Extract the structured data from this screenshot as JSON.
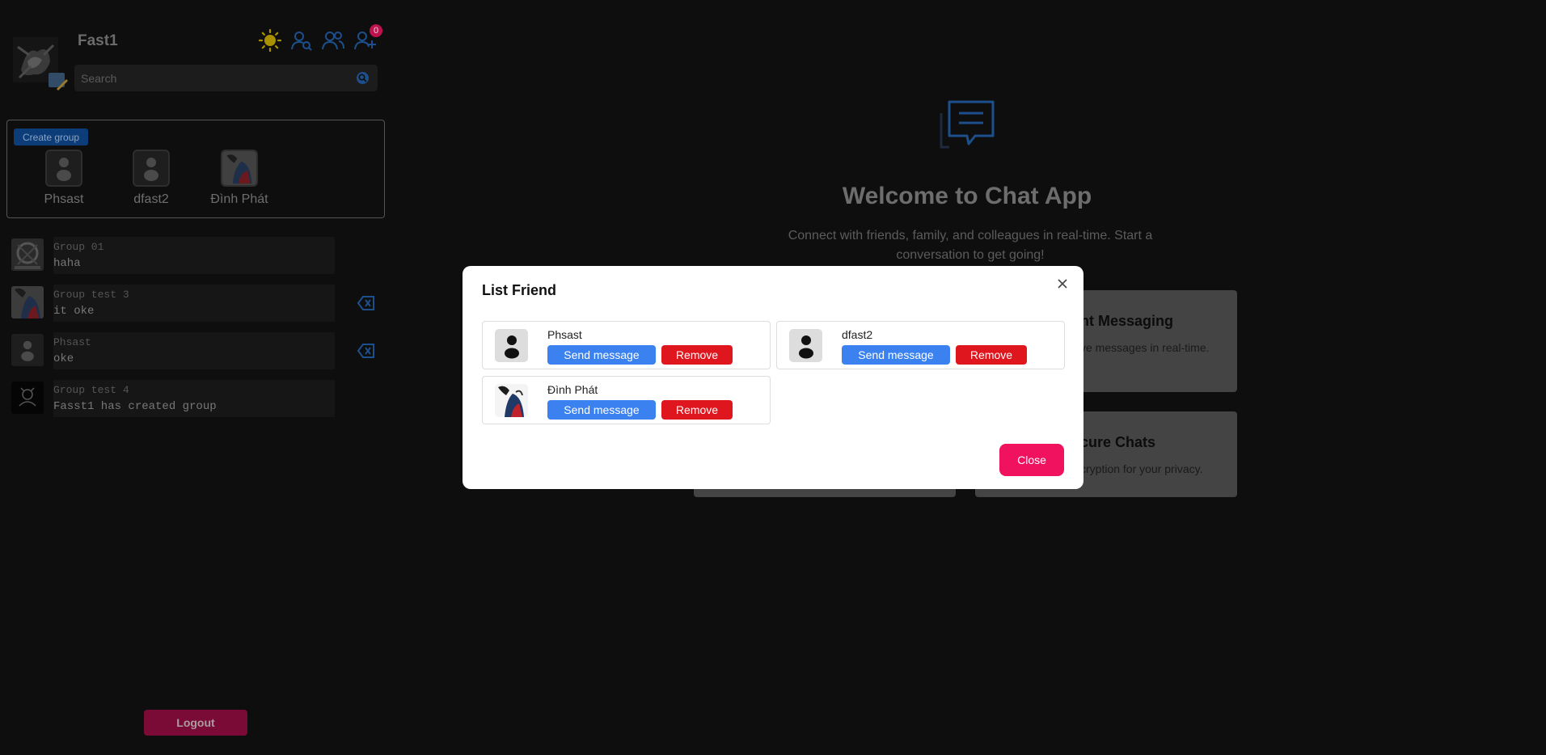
{
  "sidebar": {
    "username": "Fast1",
    "notification_count": "0",
    "search": {
      "placeholder": "Search"
    },
    "create_group_label": "Create group",
    "friends": [
      {
        "name": "Phsast",
        "avatar": "default-avatar"
      },
      {
        "name": "dfast2",
        "avatar": "default-avatar"
      },
      {
        "name": "Đình Phát",
        "avatar": "photo-avatar"
      }
    ],
    "conversations": [
      {
        "title": "Group 01",
        "last_message": "haha",
        "deletable": false
      },
      {
        "title": "Group test 3",
        "last_message": "it oke",
        "deletable": true
      },
      {
        "title": "Phsast",
        "last_message": "oke",
        "deletable": true
      },
      {
        "title": "Group test 4",
        "last_message": "Fasst1 has created group",
        "deletable": false
      }
    ],
    "logout_label": "Logout",
    "icons": [
      "sun-icon",
      "user-search-icon",
      "users-icon",
      "user-plus-icon"
    ]
  },
  "main": {
    "title": "Welcome to Chat App",
    "subtitle": "Connect with friends, family, and colleagues in real-time. Start a conversation to get going!",
    "features": [
      {
        "title": "nt Messaging",
        "desc": "ve messages in real-time."
      },
      {
        "title": "cure Chats",
        "desc": "cryption for your privacy."
      }
    ]
  },
  "modal": {
    "title": "List Friend",
    "friends": [
      {
        "name": "Phsast",
        "send_label": "Send message",
        "remove_label": "Remove"
      },
      {
        "name": "dfast2",
        "send_label": "Send message",
        "remove_label": "Remove"
      },
      {
        "name": "Đình Phát",
        "send_label": "Send message",
        "remove_label": "Remove"
      }
    ],
    "close_label": "Close"
  },
  "colors": {
    "background": "#0e0e0e",
    "accent_blue": "#3b82f0",
    "danger_red": "#e0161e",
    "close_pink": "#f0125e",
    "logout": "#7a0b36"
  }
}
